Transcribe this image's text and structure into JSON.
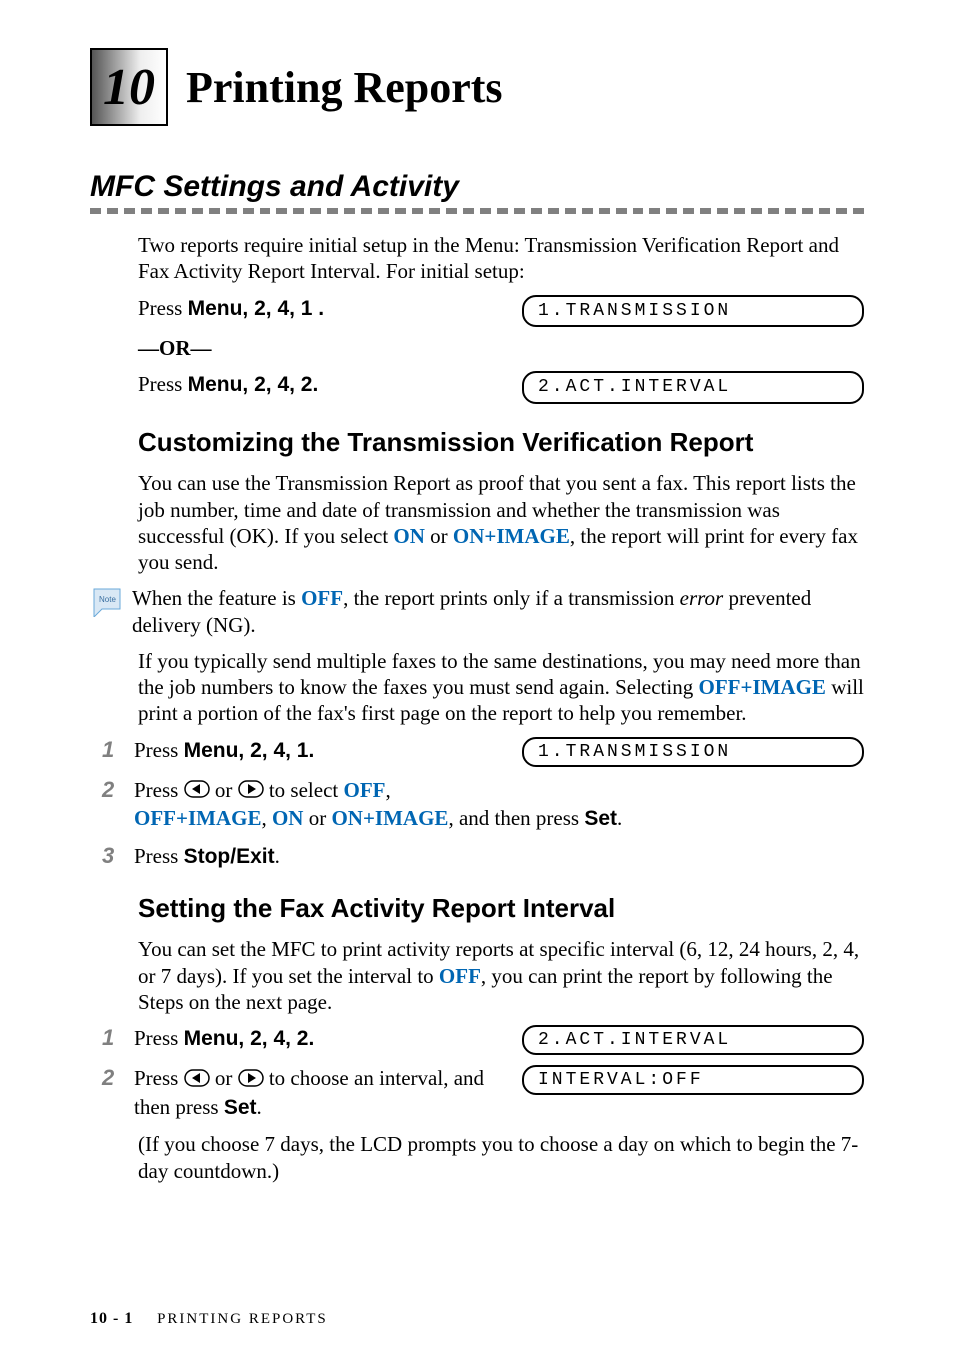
{
  "chapter": {
    "number": "10",
    "title": "Printing Reports"
  },
  "section": {
    "title": "MFC Settings and Activity",
    "intro": "Two reports require initial setup in the Menu: Transmission Verification Report and Fax Activity Report Interval. For initial setup:",
    "press1_prefix": "Press ",
    "press1_keys": "Menu",
    "press1_seq": ", 2, 4, 1 .",
    "or": "—OR—",
    "press2_prefix": "Press ",
    "press2_keys": "Menu",
    "press2_seq": ", 2, 4, 2.",
    "lcd1": "1.TRANSMISSION",
    "lcd2": "2.ACT.INTERVAL"
  },
  "sub1": {
    "title": "Customizing the Transmission Verification Report",
    "para1_a": "You can use the Transmission Report as proof that you sent a fax. This report lists the job number, time and date of transmission and whether the transmission was successful (OK). If you select ",
    "on": "ON",
    "or_word": " or ",
    "on_image": "ON+IMAGE",
    "para1_b": ", the report will print for every fax you send.",
    "note_a": "When the feature is ",
    "off": "OFF",
    "note_b": ", the report prints only if a transmission ",
    "error": "error",
    "note_c": " prevented delivery (NG).",
    "para2_a": "If you typically send multiple faxes to the same destinations, you may need more than the job numbers to know the faxes you must send again. Selecting ",
    "off_image": "OFF+IMAGE",
    "para2_b": " will print a portion of the fax's first page on the report to help you remember.",
    "step1_prefix": "Press ",
    "step1_keys": "Menu",
    "step1_seq": ", 2, 4, 1.",
    "step1_lcd": "1.TRANSMISSION",
    "step2_a": "Press ",
    "step2_b": " or ",
    "step2_c": " to select ",
    "step2_off": "OFF",
    "step2_line2a": "OFF+IMAGE",
    "step2_line2b": ", ",
    "step2_line2c": "ON",
    "step2_line2d": " or ",
    "step2_line2e": "ON+IMAGE",
    "step2_line2f": ", and then press ",
    "set": "Set",
    "step2_line2g": ".",
    "step3_prefix": "Press ",
    "step3_key": "Stop/Exit",
    "step3_suffix": ".",
    "n1": "1",
    "n2": "2",
    "n3": "3"
  },
  "sub2": {
    "title": "Setting the Fax Activity Report Interval",
    "para_a": "You can set the MFC to print activity reports at specific interval (6, 12, 24 hours, 2, 4, or 7 days). If you set the interval to ",
    "off": "OFF",
    "para_b": ", you can print the report by following the Steps on the next page.",
    "step1_prefix": "Press ",
    "step1_keys": "Menu",
    "step1_seq": ", 2, 4, 2.",
    "step1_lcd": "2.ACT.INTERVAL",
    "step2_a": "Press ",
    "step2_b": " or ",
    "step2_c": " to choose an interval, and then press ",
    "set": "Set",
    "step2_d": ".",
    "step2_lcd": "INTERVAL:OFF",
    "tail": "(If you choose 7 days, the LCD prompts you to choose a day on which to begin the 7-day countdown.)",
    "n1": "1",
    "n2": "2"
  },
  "footer": {
    "page": "10 - 1",
    "label": "PRINTING REPORTS"
  },
  "note_label": "Note"
}
